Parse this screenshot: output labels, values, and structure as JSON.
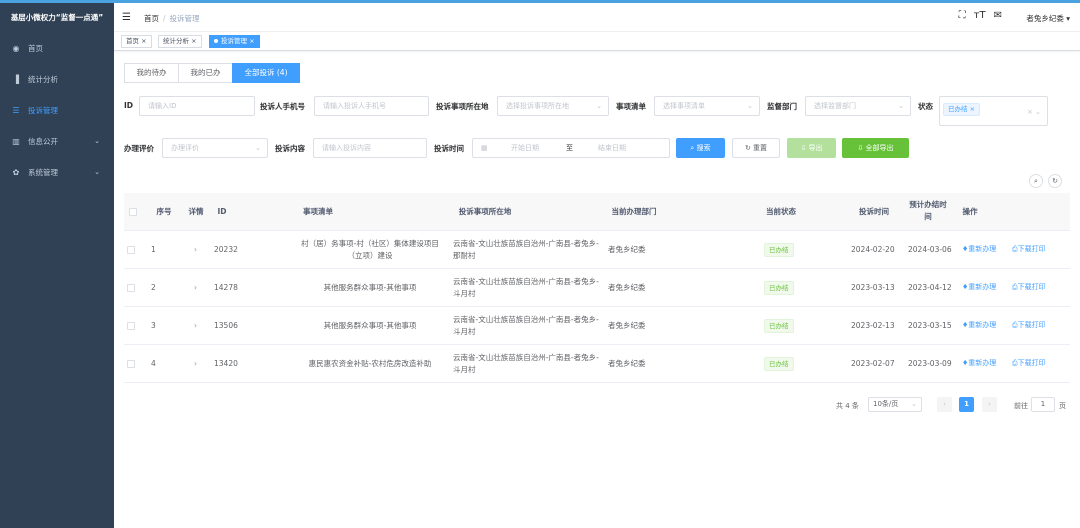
{
  "app": {
    "title": "基层小微权力“监督一点通”"
  },
  "sidebar": {
    "items": [
      {
        "label": "首页",
        "icon": "dashboard-icon"
      },
      {
        "label": "统计分析",
        "icon": "bar-chart-icon"
      },
      {
        "label": "投诉管理",
        "icon": "list-icon"
      },
      {
        "label": "信息公开",
        "icon": "book-icon"
      },
      {
        "label": "系统管理",
        "icon": "gear-icon"
      }
    ]
  },
  "header": {
    "breadcrumb": [
      "首页",
      "投诉管理"
    ],
    "user": "者兔乡纪委"
  },
  "tags": [
    "首页",
    "统计分析",
    "投诉管理"
  ],
  "tabs": [
    "我的待办",
    "我的已办",
    "全部投诉 (4)"
  ],
  "filters": {
    "id_label": "ID",
    "id_placeholder": "请输入ID",
    "phone_label": "投诉人手机号",
    "phone_placeholder": "请输入投诉人手机号",
    "location_label": "投诉事项所在地",
    "location_placeholder": "选择投诉事项所在地",
    "item_label": "事项清单",
    "item_placeholder": "选择事项清单",
    "dept_label": "监督部门",
    "dept_placeholder": "选择监督部门",
    "status_label": "状态",
    "status_chip": "已办结",
    "eval_label": "办理评价",
    "eval_placeholder": "办理评价",
    "content_label": "投诉内容",
    "content_placeholder": "请输入投诉内容",
    "time_label": "投诉时间",
    "start_placeholder": "开始日期",
    "to": "至",
    "end_placeholder": "结束日期"
  },
  "buttons": {
    "search": "搜索",
    "reset": "重置",
    "export": "导出",
    "export_all": "全部导出"
  },
  "table": {
    "columns": [
      "序号",
      "详情",
      "ID",
      "事项清单",
      "投诉事项所在地",
      "当前办理部门",
      "当前状态",
      "投诉时间",
      "预计办结时间",
      "操作"
    ],
    "rows": [
      {
        "no": "1",
        "id": "20232",
        "item": "村（居）务事项-村（社区）集体建设项目（立项）建设",
        "loc": "云南省-文山壮族苗族自治州-广南县-者兔乡-那耐村",
        "dept": "者兔乡纪委",
        "status": "已办结",
        "time": "2024-02-20",
        "due": "2024-03-06"
      },
      {
        "no": "2",
        "id": "14278",
        "item": "其他服务群众事项-其他事项",
        "loc": "云南省-文山壮族苗族自治州-广南县-者兔乡-斗月村",
        "dept": "者兔乡纪委",
        "status": "已办结",
        "time": "2023-03-13",
        "due": "2023-04-12"
      },
      {
        "no": "3",
        "id": "13506",
        "item": "其他服务群众事项-其他事项",
        "loc": "云南省-文山壮族苗族自治州-广南县-者兔乡-斗月村",
        "dept": "者兔乡纪委",
        "status": "已办结",
        "time": "2023-02-13",
        "due": "2023-03-15"
      },
      {
        "no": "4",
        "id": "13420",
        "item": "惠民惠农资金补贴-农村危房改造补助",
        "loc": "云南省-文山壮族苗族自治州-广南县-者兔乡-斗月村",
        "dept": "者兔乡纪委",
        "status": "已办结",
        "time": "2023-02-07",
        "due": "2023-03-09"
      }
    ],
    "ops": {
      "redo": "重新办理",
      "print": "下载打印"
    }
  },
  "pagination": {
    "total": "共 4 条",
    "size": "10条/页",
    "page": "1",
    "goto": "前往",
    "goto_value": "1",
    "unit": "页"
  }
}
